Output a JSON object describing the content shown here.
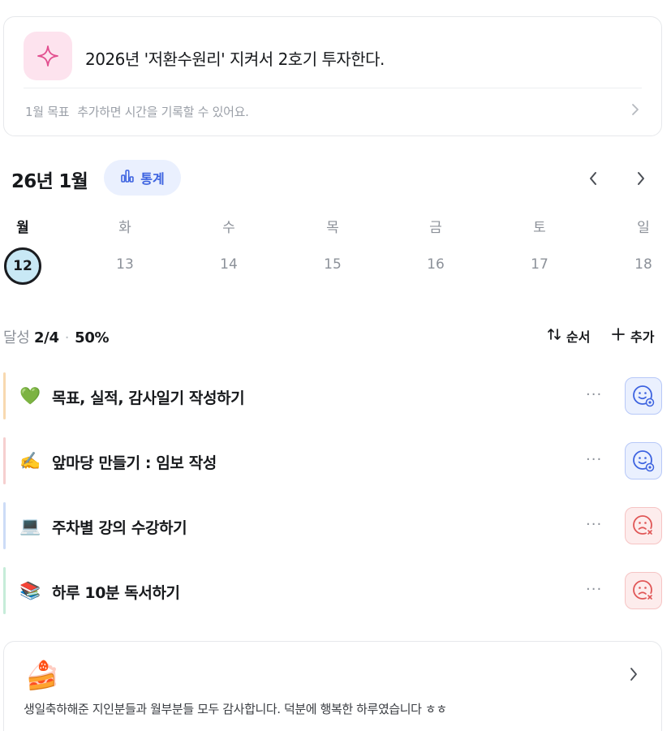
{
  "goal": {
    "icon": "sparkle-icon",
    "title": "2026년 '저환수원리' 지켜서 2호기 투자한다.",
    "month_label": "1월 목표",
    "hint": "추가하면 시간을 기록할 수 있어요."
  },
  "calendar": {
    "month_title": "26년 1월",
    "stats_label": "통계",
    "days": [
      {
        "dow": "월",
        "date": "12",
        "selected": true
      },
      {
        "dow": "화",
        "date": "13"
      },
      {
        "dow": "수",
        "date": "14"
      },
      {
        "dow": "목",
        "date": "15"
      },
      {
        "dow": "금",
        "date": "16"
      },
      {
        "dow": "토",
        "date": "17"
      },
      {
        "dow": "일",
        "date": "18"
      }
    ]
  },
  "summary": {
    "label": "달성",
    "count": "2/4",
    "percent": "50%",
    "order_label": "순서",
    "add_label": "추가"
  },
  "tasks": [
    {
      "emoji": "💚",
      "label": "목표, 실적, 감사일기 작성하기",
      "status": "done",
      "bar_color": "#f8d9b0"
    },
    {
      "emoji": "✍️",
      "label": "앞마당 만들기 : 임보 작성",
      "status": "done",
      "bar_color": "#f6cfcf"
    },
    {
      "emoji": "💻",
      "label": "주차별 강의 수강하기",
      "status": "fail",
      "bar_color": "#cddcf7"
    },
    {
      "emoji": "📚",
      "label": "하루 10분 독서하기",
      "status": "fail",
      "bar_color": "#c6ecd9"
    }
  ],
  "more_label": "···",
  "memo": {
    "emoji": "🍰",
    "text": "생일축하해준 지인분들과 월부분들 모두 감사합니다. 덕분에 행복한 하루였습니다 ㅎㅎ"
  },
  "colors": {
    "accent_blue": "#3d63e0",
    "fail_red": "#e05656",
    "selected_date_bg": "#c8e8f5",
    "sparkle_pink": "#e24f8f"
  }
}
